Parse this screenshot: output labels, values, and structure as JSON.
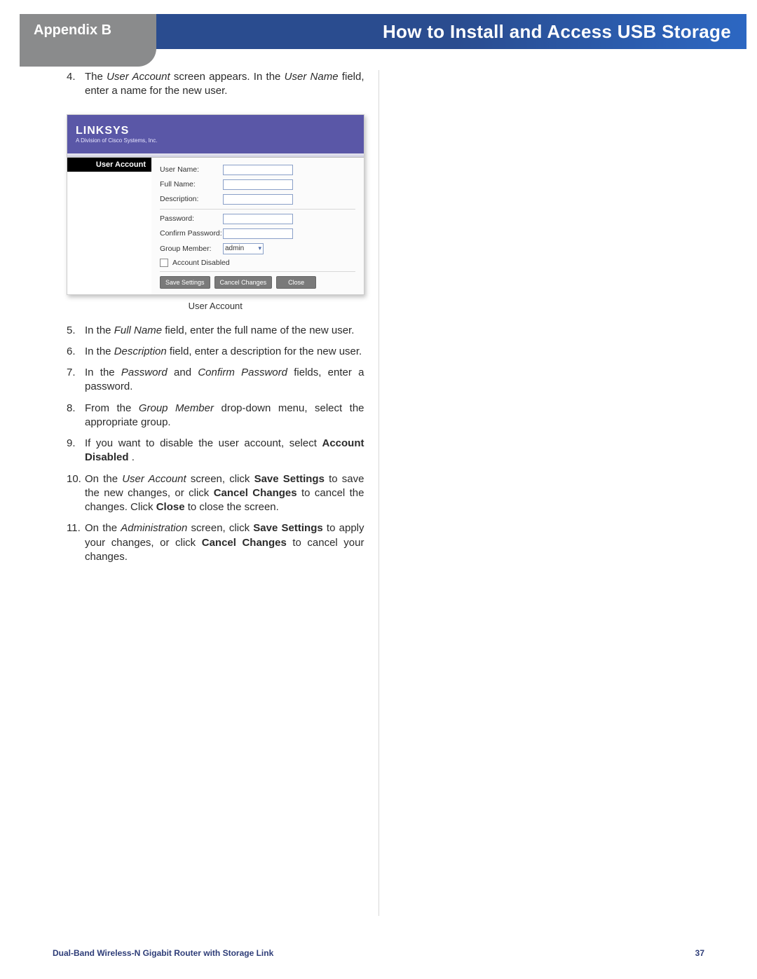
{
  "header": {
    "appendix": "Appendix B",
    "title": "How to Install and Access USB Storage"
  },
  "step4": {
    "num": "4.",
    "pre": "The ",
    "s1": "User Account",
    "mid1": " screen appears. In the ",
    "s2": "User Name",
    "post": " field, enter a name for the new user."
  },
  "figure": {
    "logo": "LINKSYS",
    "sublogo": "A Division of Cisco Systems, Inc.",
    "tab": "User Account",
    "labels": {
      "username": "User Name:",
      "fullname": "Full Name:",
      "description": "Description:",
      "password": "Password:",
      "confirm": "Confirm Password:",
      "group": "Group Member:",
      "disabled": "Account Disabled"
    },
    "group_value": "admin",
    "buttons": {
      "save": "Save Settings",
      "cancel": "Cancel Changes",
      "close": "Close"
    },
    "caption": "User Account"
  },
  "step5": {
    "num": "5.",
    "pre": "In the ",
    "s1": "Full Name",
    "post": " field, enter the full name of the new user."
  },
  "step6": {
    "num": "6.",
    "pre": "In the ",
    "s1": "Description",
    "post": " field, enter a description for the new user."
  },
  "step7": {
    "num": "7.",
    "pre": "In the ",
    "s1": "Password",
    "mid": " and ",
    "s2": "Confirm Password",
    "post": " fields, enter a password."
  },
  "step8": {
    "num": "8.",
    "pre": "From the ",
    "s1": "Group Member",
    "post": " drop-down menu, select the appropriate group."
  },
  "step9": {
    "num": "9.",
    "pre": "If you want to disable the user account, select ",
    "b1": "Account Disabled",
    "post": "."
  },
  "step10": {
    "num": "10.",
    "pre": "On the ",
    "s1": "User Account",
    "mid1": " screen, click ",
    "b1": "Save Settings",
    "mid2": " to save the new changes, or click ",
    "b2": "Cancel Changes",
    "mid3": " to cancel the changes. Click ",
    "b3": "Close",
    "post": " to close the screen."
  },
  "step11": {
    "num": "11.",
    "pre": "On the ",
    "s1": "Administration",
    "mid1": " screen, click ",
    "b1": "Save Settings",
    "mid2": " to apply your changes, or click ",
    "b2": "Cancel Changes",
    "post": " to cancel your changes."
  },
  "footer": {
    "product": "Dual-Band Wireless-N Gigabit Router with Storage Link",
    "page": "37"
  }
}
